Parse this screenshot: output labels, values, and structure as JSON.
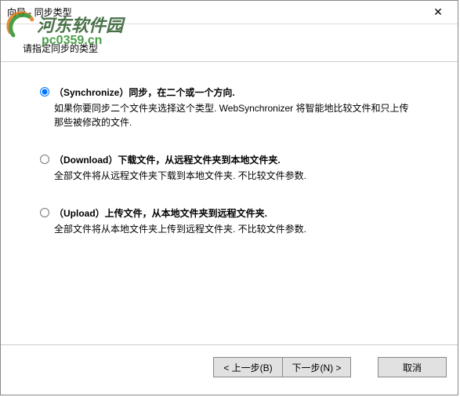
{
  "window": {
    "title": "向导 - 同步类型"
  },
  "header": {
    "instruction": "请指定同步的类型"
  },
  "options": {
    "sync": {
      "title": "（Synchronize）同步，在二个或一个方向.",
      "desc": "如果你要同步二个文件夹选择这个类型. WebSynchronizer 将智能地比较文件和只上传 那些被修改的文件."
    },
    "download": {
      "title": "（Download）下载文件，从远程文件夹到本地文件夹.",
      "desc": "全部文件将从远程文件夹下载到本地文件夹. 不比较文件参数."
    },
    "upload": {
      "title": "（Upload）上传文件，从本地文件夹到远程文件夹.",
      "desc": "全部文件将从本地文件夹上传到远程文件夹. 不比较文件参数."
    }
  },
  "buttons": {
    "back": "< 上一步(B)",
    "next": "下一步(N) >",
    "cancel": "取消"
  },
  "watermark": {
    "brand": "河东软件园",
    "url": "pc0359.cn"
  }
}
